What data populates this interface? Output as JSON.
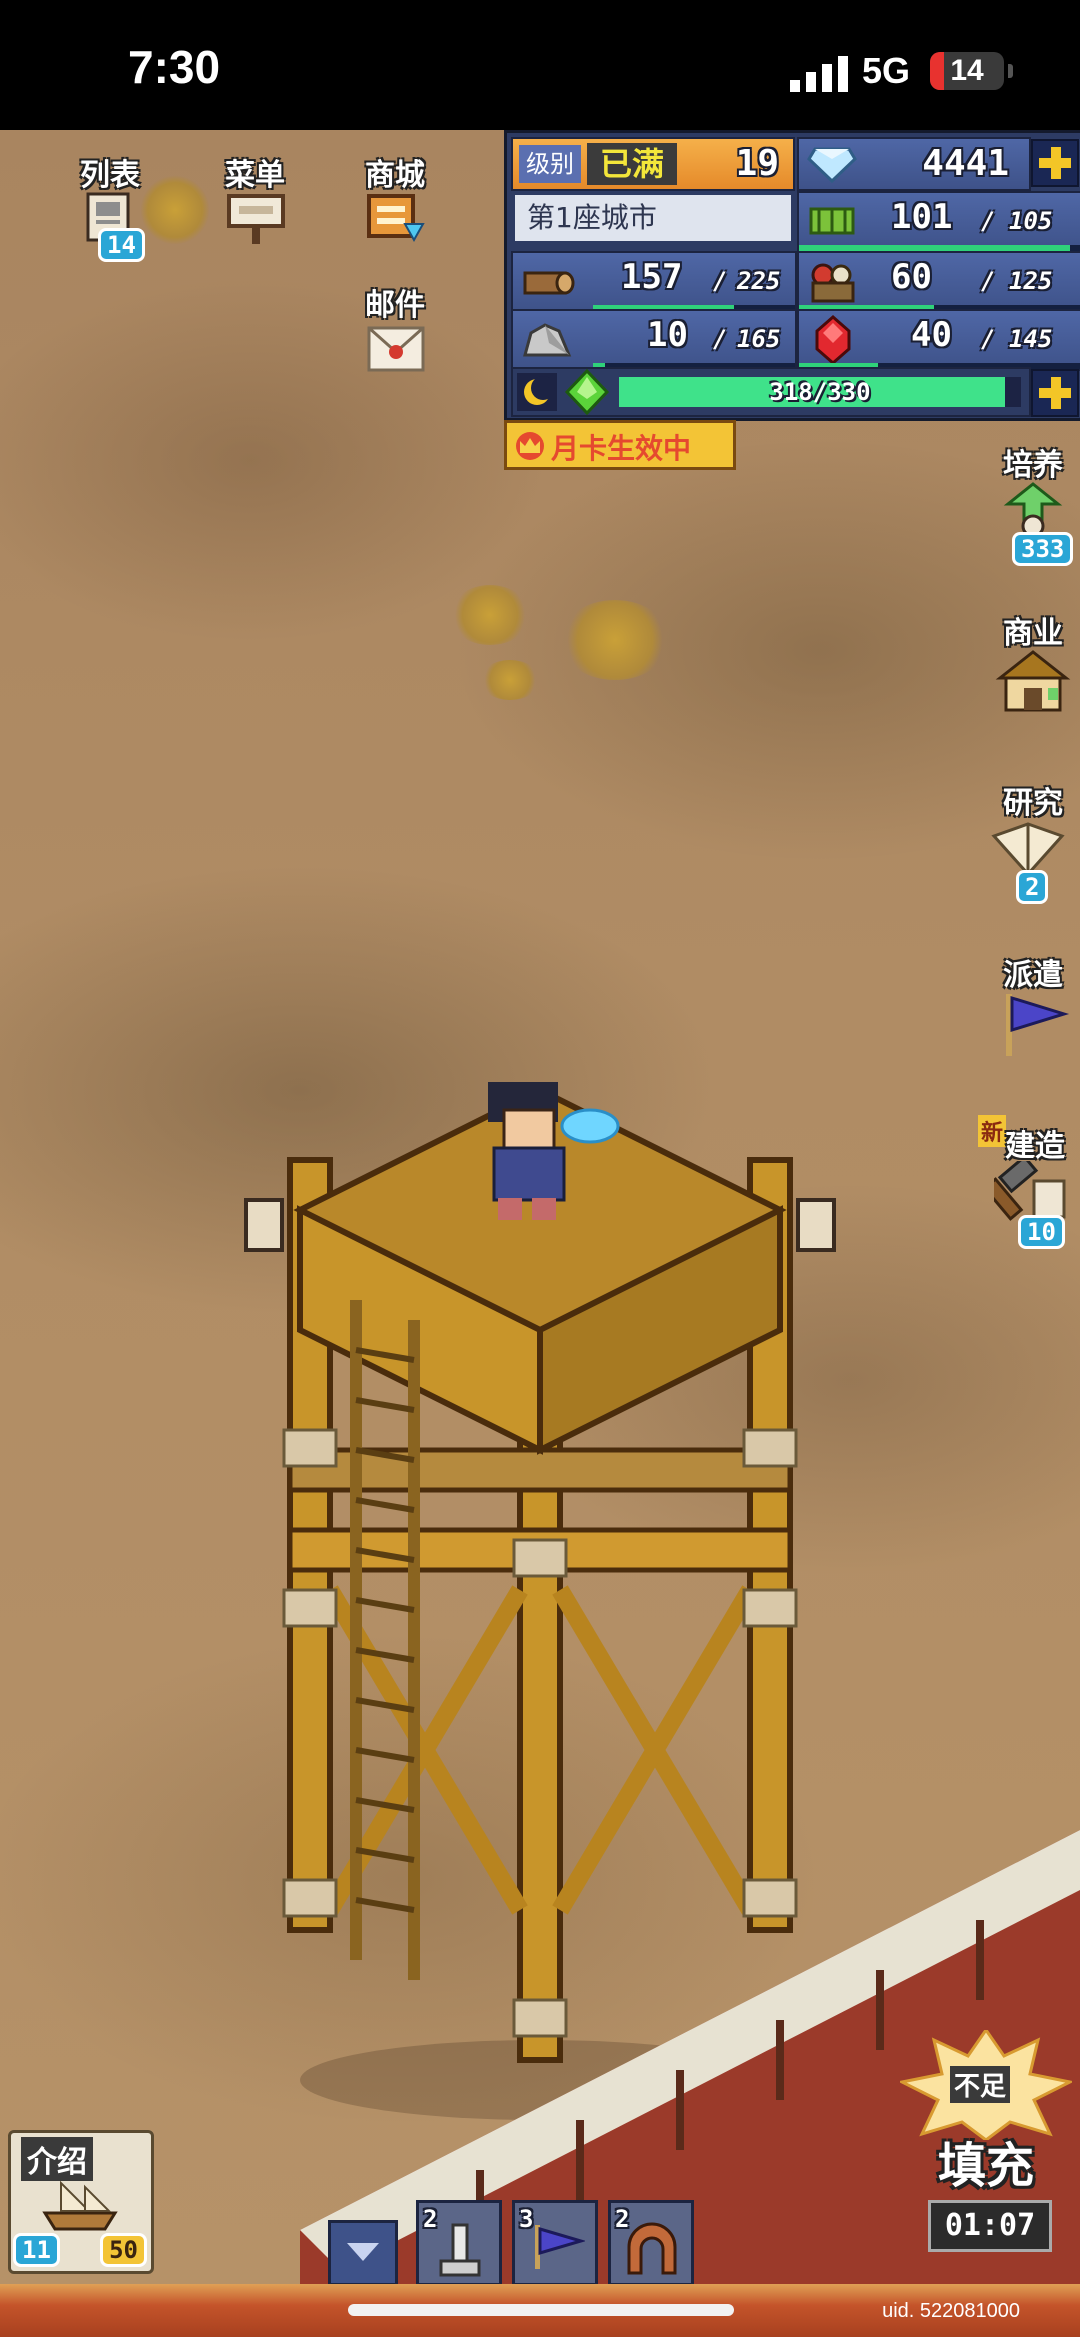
{
  "status_bar": {
    "time": "7:30",
    "network": "5G",
    "battery": "14"
  },
  "top_buttons": [
    {
      "label": "列表",
      "badge": "14",
      "icon": "scroll-list-icon"
    },
    {
      "label": "菜单",
      "icon": "signboard-icon"
    },
    {
      "label": "商城",
      "icon": "shop-chest-icon"
    },
    {
      "label": "邮件",
      "icon": "mail-envelope-icon"
    }
  ],
  "hud": {
    "level_label": "级别",
    "level_status": "已满",
    "level_value": "19",
    "gems": "4441",
    "city_name": "第1座城市",
    "resources": {
      "crop": {
        "current": "101",
        "max": "105",
        "fill": 0.96
      },
      "wood": {
        "current": "157",
        "max": "225",
        "fill": 0.7
      },
      "food": {
        "current": "60",
        "max": "125",
        "fill": 0.48
      },
      "stone": {
        "current": "10",
        "max": "165",
        "fill": 0.06
      },
      "ruby": {
        "current": "40",
        "max": "145",
        "fill": 0.28
      }
    },
    "energy": {
      "current": "318",
      "max": "330",
      "fill": 0.96
    },
    "month_card": "月卡生效中"
  },
  "side_buttons": [
    {
      "label": "培养",
      "badge": "333",
      "icon": "training-icon"
    },
    {
      "label": "商业",
      "icon": "shop-house-icon"
    },
    {
      "label": "研究",
      "badge": "2",
      "icon": "research-book-icon"
    },
    {
      "label": "派遣",
      "icon": "dispatch-flag-icon"
    },
    {
      "label": "建造",
      "badge": "10",
      "new_tag": "新",
      "icon": "build-hammer-icon"
    }
  ],
  "bottom": {
    "intro_label": "介绍",
    "intro_left_badge": "11",
    "intro_right_badge": "50",
    "queue": [
      {
        "count": "2",
        "icon": "tower-icon"
      },
      {
        "count": "3",
        "icon": "flag-icon"
      },
      {
        "count": "2",
        "icon": "arch-icon"
      }
    ],
    "refill_top": "不足",
    "refill_label": "填充",
    "refill_timer": "01:07",
    "uid": "uid. 522081000"
  },
  "colors": {
    "gold": "#c8952a",
    "green_bar": "#2fd27a",
    "hud_blue": "#3e5289"
  }
}
